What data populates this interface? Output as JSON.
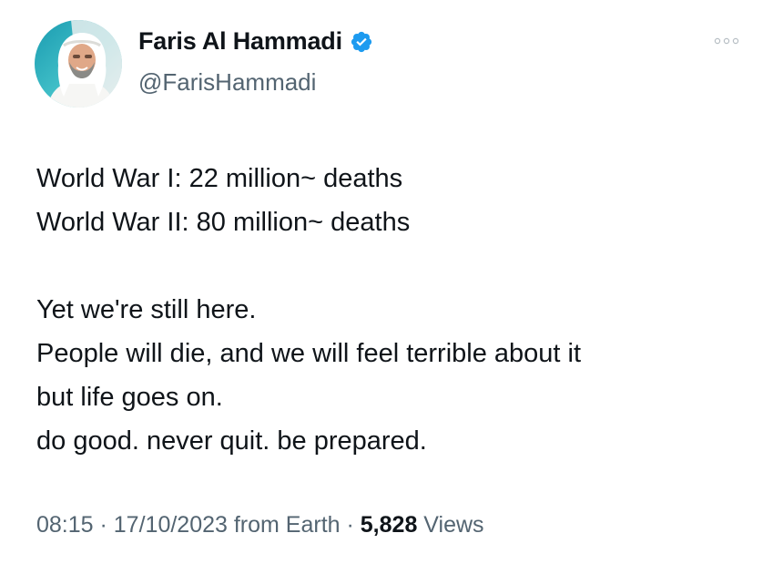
{
  "author": {
    "display_name": "Faris Al Hammadi",
    "handle": "@FarisHammadi",
    "verified": true,
    "avatar_icon": "user-avatar-photo",
    "verified_icon": "verified-badge-icon",
    "verified_color": "#1d9bf0"
  },
  "menu": {
    "icon": "more-options-icon"
  },
  "tweet": {
    "lines": [
      "World War I: 22 million~ deaths",
      "World War II: 80 million~ deaths",
      "",
      "Yet we're still here.",
      "People will die, and we will feel terrible about it",
      "but life goes on.",
      "do good. never quit. be prepared."
    ]
  },
  "meta": {
    "time": "08:15",
    "separator": " · ",
    "date": "17/10/2023",
    "source": "from Earth",
    "views_count": "5,828",
    "views_label": "Views"
  },
  "colors": {
    "text_primary": "#0f1419",
    "text_secondary": "#536471",
    "accent": "#1d9bf0"
  }
}
